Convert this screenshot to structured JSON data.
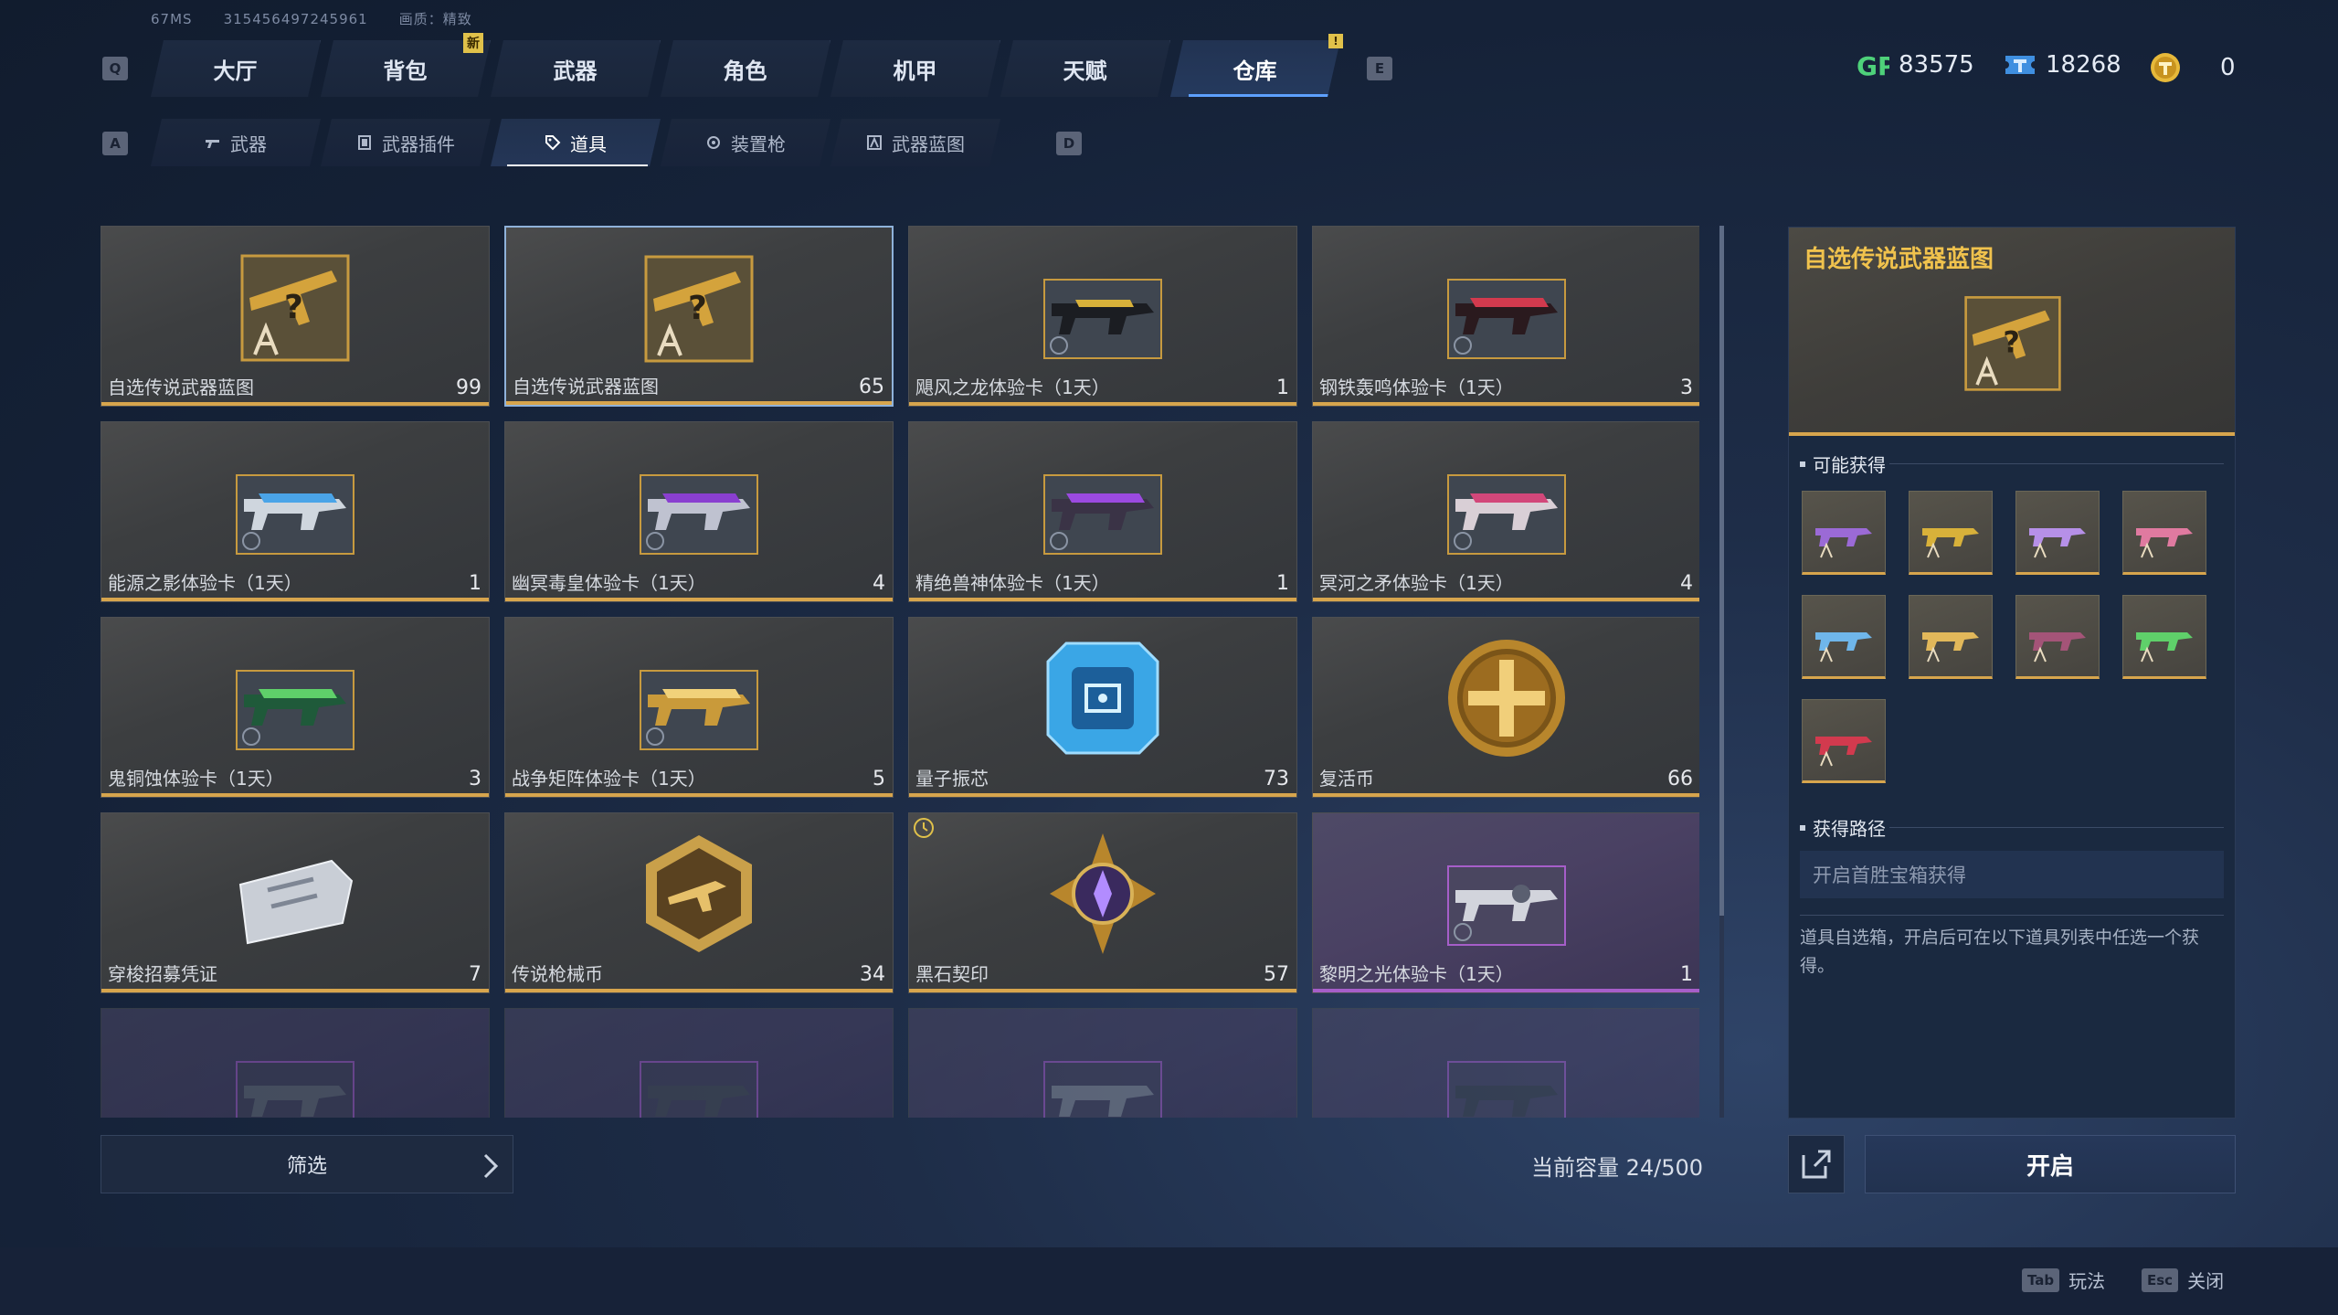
{
  "debug": {
    "ping": "67MS",
    "uid": "315456497245961",
    "quality": "画质：精致"
  },
  "keys": {
    "prev_tab": "Q",
    "next_tab": "E",
    "prev_sub": "A",
    "next_sub": "D"
  },
  "top_tabs": [
    {
      "label": "大厅"
    },
    {
      "label": "背包"
    },
    {
      "label": "武器"
    },
    {
      "label": "角色"
    },
    {
      "label": "机甲"
    },
    {
      "label": "天赋"
    },
    {
      "label": "仓库"
    }
  ],
  "badges": {
    "new": "新",
    "alert": "!"
  },
  "currencies": [
    {
      "icon": "gp-icon",
      "value": "83575"
    },
    {
      "icon": "ticket-icon",
      "value": "18268"
    },
    {
      "icon": "coin-icon",
      "value": "0"
    }
  ],
  "sub_tabs": [
    {
      "label": "武器",
      "icon": "rifle-icon"
    },
    {
      "label": "武器插件",
      "icon": "chip-icon"
    },
    {
      "label": "道具",
      "icon": "tag-icon"
    },
    {
      "label": "装置枪",
      "icon": "device-gun-icon"
    },
    {
      "label": "武器蓝图",
      "icon": "blueprint-icon"
    }
  ],
  "items": [
    {
      "name": "自选传说武器蓝图",
      "count": "99",
      "icon": "blueprint-box-icon"
    },
    {
      "name": "自选传说武器蓝图",
      "count": "65",
      "icon": "blueprint-box-icon"
    },
    {
      "name": "飓风之龙体验卡（1天）",
      "count": "1",
      "icon": "gun-card-icon"
    },
    {
      "name": "钢铁轰鸣体验卡（1天）",
      "count": "3",
      "icon": "gun-card-icon"
    },
    {
      "name": "能源之影体验卡（1天）",
      "count": "1",
      "icon": "gun-card-icon"
    },
    {
      "name": "幽冥毒皇体验卡（1天）",
      "count": "4",
      "icon": "gun-card-icon"
    },
    {
      "name": "精绝兽神体验卡（1天）",
      "count": "1",
      "icon": "gun-card-icon"
    },
    {
      "name": "冥河之矛体验卡（1天）",
      "count": "4",
      "icon": "gun-card-icon"
    },
    {
      "name": "鬼铜蚀体验卡（1天）",
      "count": "3",
      "icon": "gun-card-icon"
    },
    {
      "name": "战争矩阵体验卡（1天）",
      "count": "5",
      "icon": "gun-card-icon"
    },
    {
      "name": "量子振芯",
      "count": "73",
      "icon": "quantum-chip-icon"
    },
    {
      "name": "复活币",
      "count": "66",
      "icon": "revive-coin-icon"
    },
    {
      "name": "穿梭招募凭证",
      "count": "7",
      "icon": "voucher-icon"
    },
    {
      "name": "传说枪械币",
      "count": "34",
      "icon": "gun-coin-icon"
    },
    {
      "name": "黑石契印",
      "count": "57",
      "icon": "black-seal-icon"
    },
    {
      "name": "黎明之光体验卡（1天）",
      "count": "1",
      "icon": "gun-card-icon"
    }
  ],
  "colors": {
    "gold_rarity": "#d7a54d",
    "purple_rarity": "#a65ec9",
    "accent_blue": "#5ea0ff",
    "title_gold": "#f0c24d",
    "gp_green": "#4ed17a"
  },
  "filter": {
    "label": "筛选"
  },
  "capacity": {
    "label": "当前容量 24/500"
  },
  "detail": {
    "title": "自选传说武器蓝图",
    "possible_label": "可能获得",
    "route_label": "获得路径",
    "route_value": "开启首胜宝箱获得",
    "description": "道具自选箱，开启后可在以下道具列表中任选一个获得。"
  },
  "actions": {
    "open": "开启"
  },
  "footer": [
    {
      "key": "Tab",
      "label": "玩法"
    },
    {
      "key": "Esc",
      "label": "关闭"
    }
  ]
}
